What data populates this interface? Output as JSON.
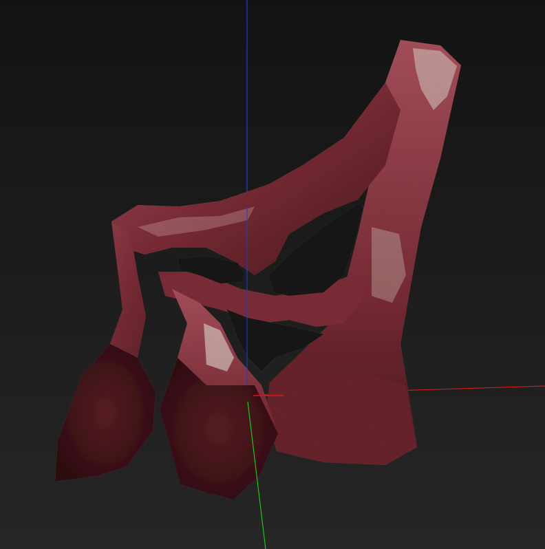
{
  "viewport": {
    "background_top": "#131313",
    "background_bottom": "#262626"
  },
  "axes": {
    "x_axis_color": "#d41a1a",
    "y_axis_color": "#1a3fd8",
    "z_axis_color": "#18c81e"
  },
  "model": {
    "flesh_base": "#7a2c35",
    "flesh_light": "#a8505c",
    "flesh_dark": "#4a161d",
    "highlight": "#d8d2c4",
    "interior_shadow": "#3a1116"
  }
}
